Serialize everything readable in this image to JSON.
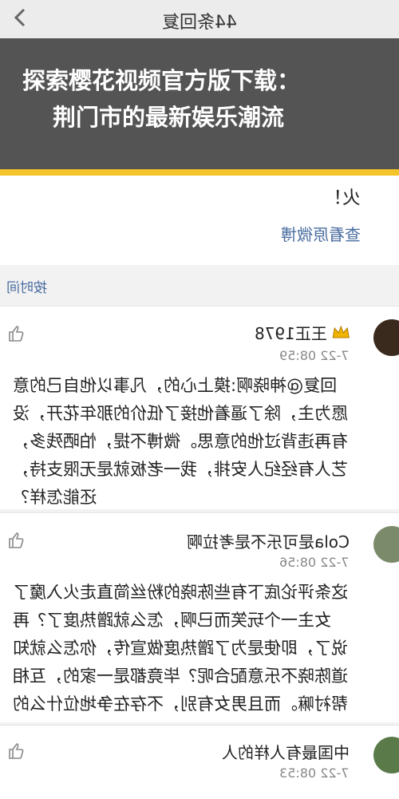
{
  "header": {
    "title": "44条回复"
  },
  "overlay": {
    "line1": "探索樱花视频官方版下载：",
    "line2": "荆门市的最新娱乐潮流"
  },
  "top_post": {
    "line1": "火！",
    "view_label": "查看原微博"
  },
  "sort": {
    "label": "按时间"
  },
  "comments": [
    {
      "name": "王正1978",
      "time": "7-22 08:59",
      "lines": [
        "回复@神晓啊:摸上心的，凡事以他自己的意",
        "愿为主，除了逼着他接了低价的那年花开，没",
        "有再违背过他的意思。微博不提，怕晒残多，",
        "艺人有经纪人安排，我一老板就是无限支持，",
        "还能怎样？"
      ]
    },
    {
      "name": "Cola是可乐不是考拉啊",
      "time": "7-22 08:56",
      "lines": [
        "这条评论底下有些陈晓的粉丝简直走火入魔了",
        "女主一个玩笑而已啊，怎么就蹭热度了？再",
        "说了，即使是为了蹭热度做宣传，你怎么就知",
        "道陈晓不乐意配合呢？毕竟都是一家的，互相",
        "帮衬嘛。而且男女有别，不存在争地位什么的"
      ]
    },
    {
      "name": "中国最有人样的人",
      "time": "7-22 08:53",
      "lines": []
    }
  ],
  "colors": {
    "accent": "#4a6da0",
    "banner": "#f3c52a"
  }
}
